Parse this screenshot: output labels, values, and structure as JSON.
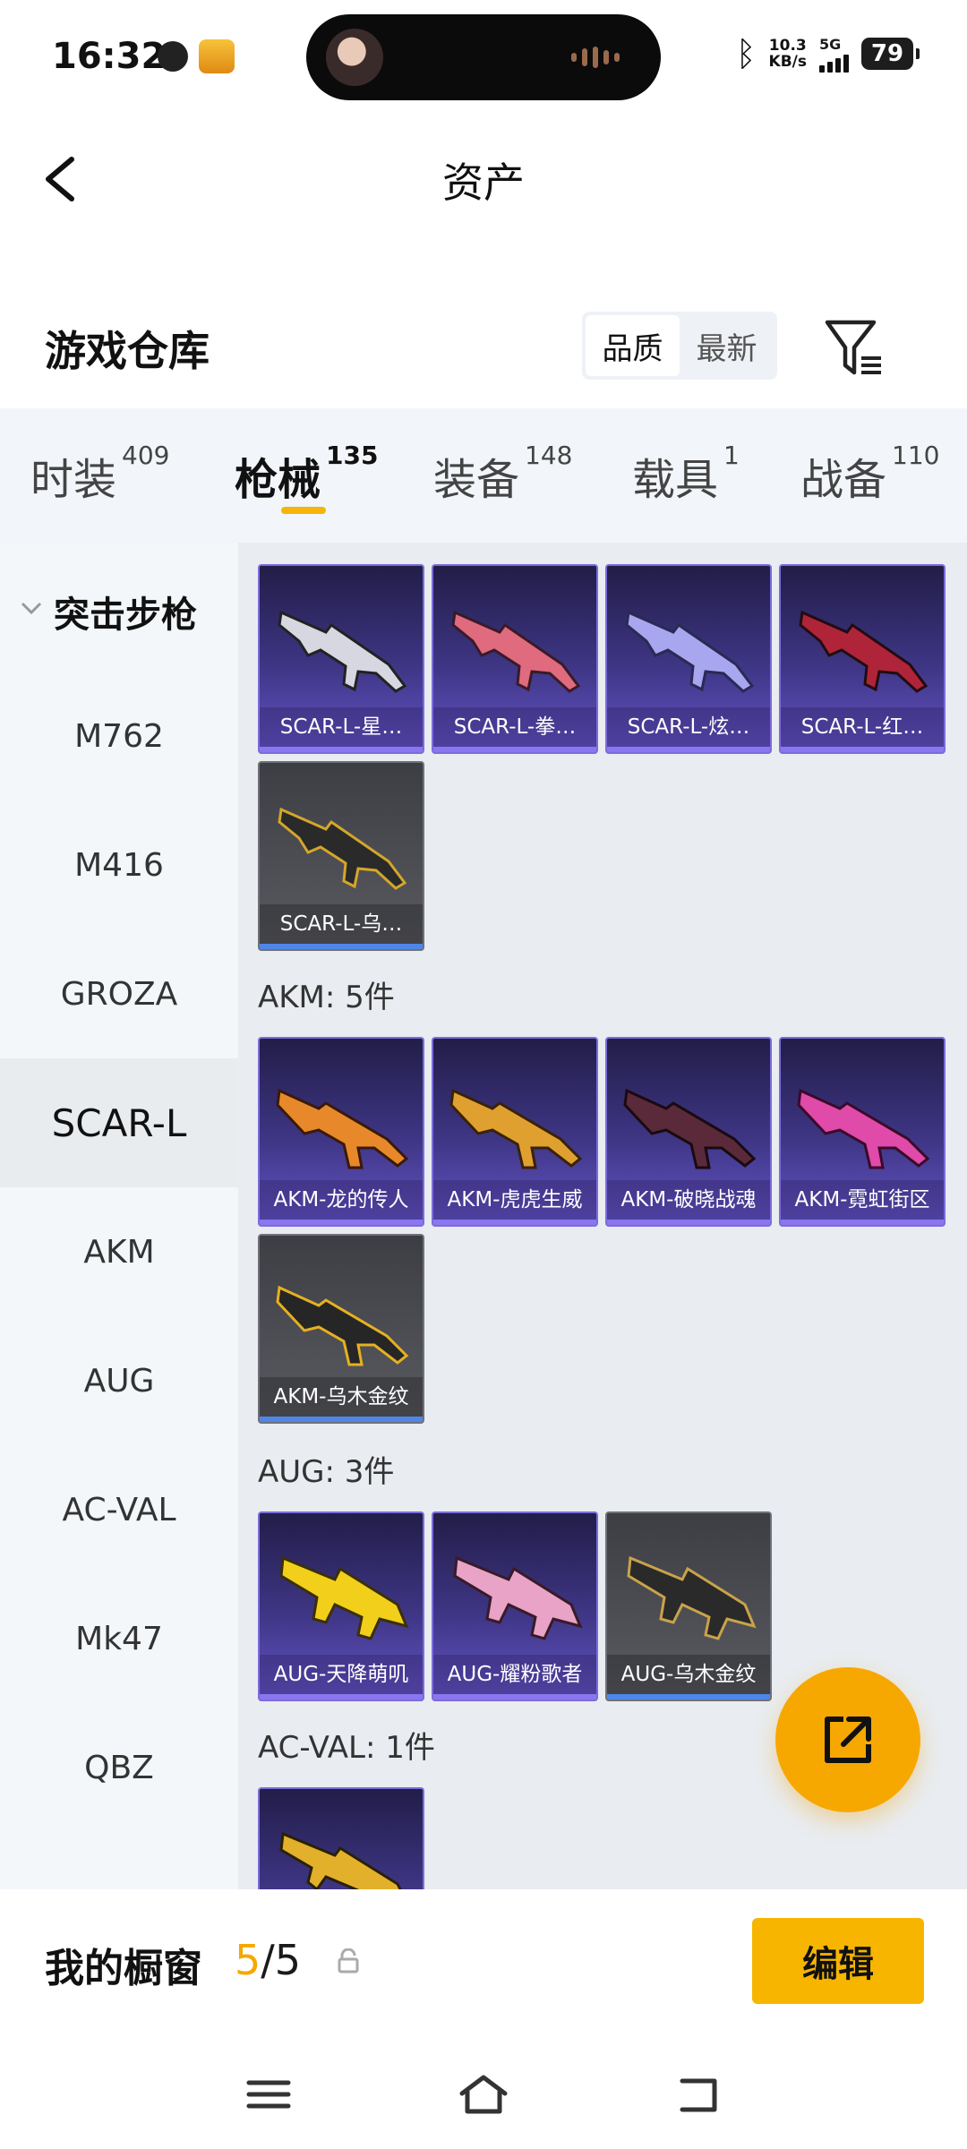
{
  "status": {
    "time": "16:32",
    "net_speed_value": "10.3",
    "net_speed_unit": "KB/s",
    "network": "5G",
    "battery": "79"
  },
  "header": {
    "title": "资产"
  },
  "section": {
    "title": "游戏仓库"
  },
  "sort": {
    "options": [
      "品质",
      "最新"
    ],
    "selected": "品质"
  },
  "categories": [
    {
      "label": "时装",
      "count": "409"
    },
    {
      "label": "枪械",
      "count": "135"
    },
    {
      "label": "装备",
      "count": "148"
    },
    {
      "label": "载具",
      "count": "1"
    },
    {
      "label": "战备",
      "count": "110"
    }
  ],
  "active_category": "枪械",
  "leftnav": {
    "group": "突击步枪",
    "items": [
      "M762",
      "M416",
      "GROZA",
      "SCAR-L",
      "AKM",
      "AUG",
      "AC-VAL",
      "Mk47",
      "QBZ"
    ],
    "active": "SCAR-L"
  },
  "groups": [
    {
      "title": "",
      "items": [
        "SCAR-L-星…",
        "SCAR-L-拳…",
        "SCAR-L-炫…",
        "SCAR-L-红…",
        "SCAR-L-乌…"
      ]
    },
    {
      "title": "AKM: 5件",
      "items": [
        "AKM-龙的传人",
        "AKM-虎虎生威",
        "AKM-破晓战魂",
        "AKM-霓虹街区",
        "AKM-乌木金纹"
      ]
    },
    {
      "title": "AUG: 3件",
      "items": [
        "AUG-天降萌叽",
        "AUG-耀粉歌者",
        "AUG-乌木金纹"
      ]
    },
    {
      "title": "AC-VAL: 1件",
      "items": [
        ""
      ]
    }
  ],
  "bottom": {
    "showcase_label": "我的橱窗",
    "current": "5",
    "total": "/5",
    "edit_label": "编辑"
  },
  "colors": {
    "accent": "#f5b50a",
    "purple_card": "#3f3686",
    "grey_card": "#5a5b61"
  }
}
